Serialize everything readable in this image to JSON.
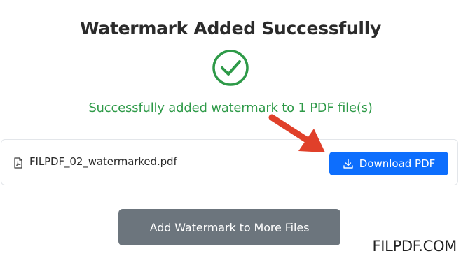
{
  "page": {
    "title": "Watermark Added Successfully",
    "success_message": "Successfully added watermark to 1 PDF file(s)",
    "status_icon": "check-circle-icon"
  },
  "file": {
    "icon": "pdf-file-icon",
    "name": "FILPDF_02_watermarked.pdf",
    "download_label": "Download PDF",
    "download_icon": "download-icon"
  },
  "actions": {
    "more_label": "Add Watermark to More Files"
  },
  "brand": {
    "watermark": "FILPDF.COM"
  },
  "colors": {
    "success": "#2e9a48",
    "primary": "#0d6efd",
    "secondary": "#6c757d",
    "annotation_arrow": "#e0402a"
  }
}
